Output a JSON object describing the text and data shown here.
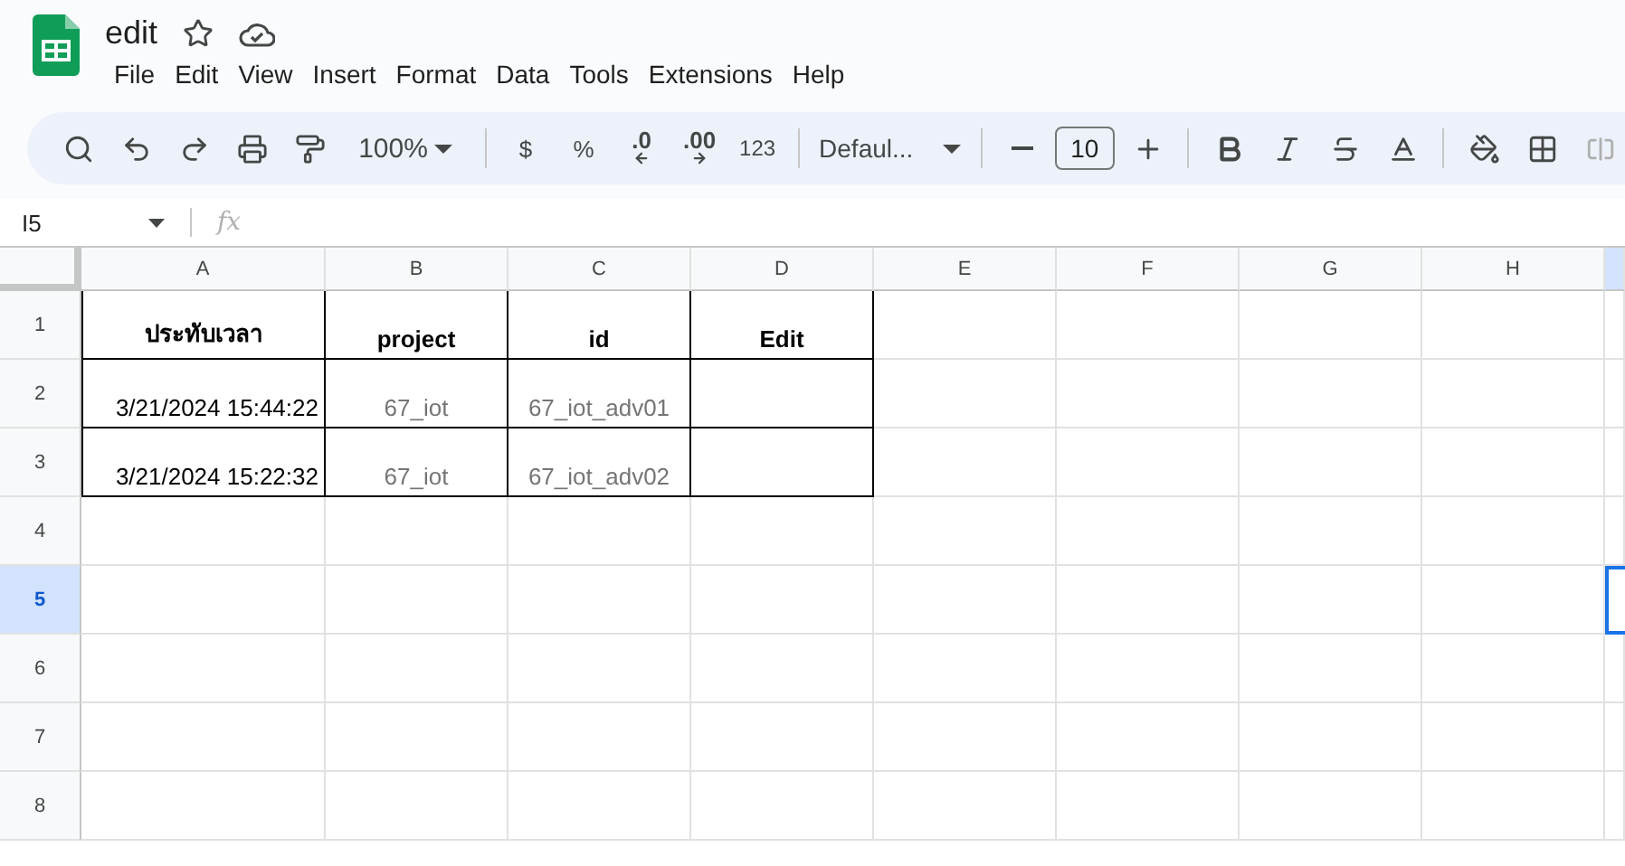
{
  "document": {
    "title": "edit"
  },
  "menu": [
    "File",
    "Edit",
    "View",
    "Insert",
    "Format",
    "Data",
    "Tools",
    "Extensions",
    "Help"
  ],
  "toolbar": {
    "zoom": "100%",
    "currency": "$",
    "percent": "%",
    "decrease_decimal": ".0",
    "increase_decimal": ".00",
    "number_format": "123",
    "font": "Defaul...",
    "font_size": "10"
  },
  "formula_bar": {
    "cell_ref": "I5",
    "function_label": "fx"
  },
  "columns": [
    {
      "label": "A",
      "selected": false
    },
    {
      "label": "B",
      "selected": false
    },
    {
      "label": "C",
      "selected": false
    },
    {
      "label": "D",
      "selected": false
    },
    {
      "label": "E",
      "selected": false
    },
    {
      "label": "F",
      "selected": false
    },
    {
      "label": "G",
      "selected": false
    },
    {
      "label": "H",
      "selected": false
    }
  ],
  "rows": [
    {
      "number": "1",
      "selected": false,
      "cells": [
        {
          "kind": "heading",
          "text": "ประทับเวลา"
        },
        {
          "kind": "heading",
          "text": "project"
        },
        {
          "kind": "heading",
          "text": "id"
        },
        {
          "kind": "heading",
          "text": "Edit"
        }
      ]
    },
    {
      "number": "2",
      "selected": false,
      "cells": [
        {
          "kind": "date",
          "text": "3/21/2024 15:44:22"
        },
        {
          "kind": "text",
          "text": "67_iot"
        },
        {
          "kind": "text",
          "text": "67_iot_adv01"
        },
        {
          "kind": "blank"
        }
      ]
    },
    {
      "number": "3",
      "selected": false,
      "cells": [
        {
          "kind": "date",
          "text": "3/21/2024 15:22:32"
        },
        {
          "kind": "text",
          "text": "67_iot"
        },
        {
          "kind": "text",
          "text": "67_iot_adv02"
        },
        {
          "kind": "blank"
        }
      ]
    },
    {
      "number": "4",
      "selected": false,
      "cells": []
    },
    {
      "number": "5",
      "selected": true,
      "cells": []
    },
    {
      "number": "6",
      "selected": false,
      "cells": []
    },
    {
      "number": "7",
      "selected": false,
      "cells": []
    },
    {
      "number": "8",
      "selected": false,
      "cells": []
    }
  ]
}
